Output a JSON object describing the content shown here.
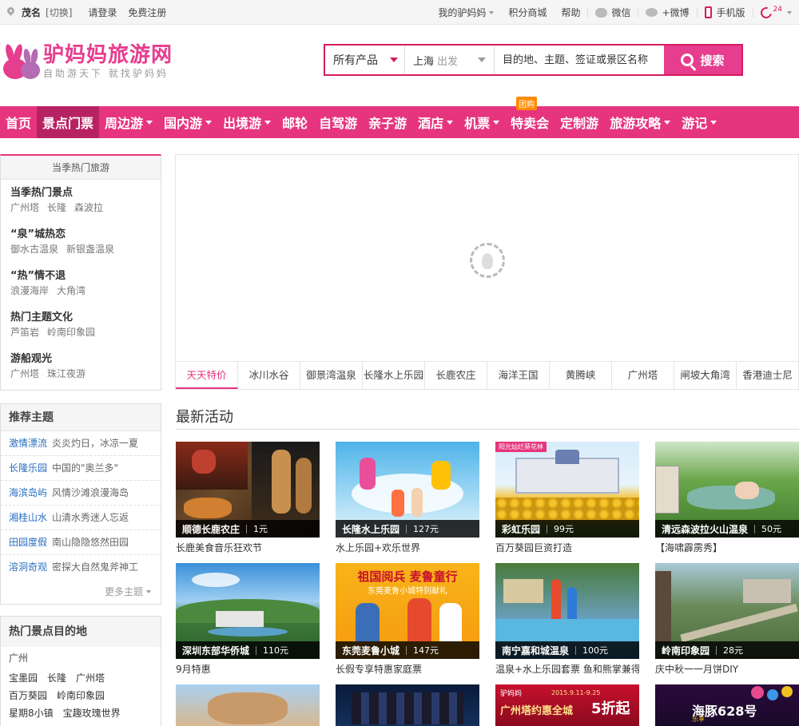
{
  "topbar": {
    "city": "茂名",
    "switch": "[切换]",
    "login": "请登录",
    "register": "免费注册",
    "my": "我的驴妈妈",
    "points": "积分商城",
    "help": "帮助",
    "wechat": "微信",
    "weibo": "+微博",
    "mobile": "手机版",
    "tel_badge": "24"
  },
  "header": {
    "logo_name": "驴妈妈旅游网",
    "slogan": "自助游天下 就找驴妈妈",
    "search": {
      "product": "所有产品",
      "city": "上海",
      "depart": "出发",
      "placeholder": "目的地、主题、签证或景区名称",
      "button": "搜索"
    }
  },
  "nav": {
    "items": [
      {
        "label": "首页"
      },
      {
        "label": "景点门票"
      },
      {
        "label": "周边游"
      },
      {
        "label": "国内游"
      },
      {
        "label": "出境游"
      },
      {
        "label": "邮轮"
      },
      {
        "label": "自驾游"
      },
      {
        "label": "亲子游"
      },
      {
        "label": "酒店"
      },
      {
        "label": "机票"
      },
      {
        "label": "特卖会",
        "badge": "团购"
      },
      {
        "label": "定制游"
      },
      {
        "label": "旅游攻略"
      },
      {
        "label": "游记"
      }
    ]
  },
  "hot": {
    "title": "当季热门旅游",
    "groups": [
      {
        "title": "当季热门景点",
        "links": [
          "广州塔",
          "长隆",
          "森波拉"
        ]
      },
      {
        "title": "“泉”城热恋",
        "links": [
          "御水古温泉",
          "新银盏温泉"
        ]
      },
      {
        "title": "“热”情不退",
        "links": [
          "浪漫海岸",
          "大角湾"
        ]
      },
      {
        "title": "热门主题文化",
        "links": [
          "芦笛岩",
          "岭南印象园"
        ]
      },
      {
        "title": "游船观光",
        "links": [
          "广州塔",
          "珠江夜游"
        ]
      }
    ]
  },
  "tabs": [
    "天天特价",
    "冰川水谷",
    "御景湾温泉",
    "长隆水上乐园",
    "长鹿农庄",
    "海洋王国",
    "黄腾峡",
    "广州塔",
    "闸坡大角湾",
    "香港迪士尼"
  ],
  "topics": {
    "title": "推荐主题",
    "rows": [
      {
        "k": "激情漂流",
        "v": "炎炎灼日，冰凉一夏"
      },
      {
        "k": "长隆乐园",
        "v": "中国的\"奥兰多\""
      },
      {
        "k": "海滨岛屿",
        "v": "风情沙滩浪漫海岛"
      },
      {
        "k": "湘桂山水",
        "v": "山清水秀迷人忘返"
      },
      {
        "k": "田园度假",
        "v": "南山隐隐悠然田园"
      },
      {
        "k": "溶洞奇观",
        "v": "密探大自然鬼斧神工"
      }
    ],
    "more": "更多主题"
  },
  "dest": {
    "title": "热门景点目的地",
    "sub": "广州",
    "rows": [
      [
        "宝墨园",
        "长隆",
        "广州塔"
      ],
      [
        "百万葵园",
        "岭南印象园"
      ],
      [
        "星期8小镇",
        "宝趣玫瑰世界"
      ]
    ]
  },
  "activities": {
    "title": "最新活动",
    "cards": [
      {
        "name": "顺德长鹿农庄",
        "price": "1元",
        "desc": "长鹿美食音乐狂欢节"
      },
      {
        "name": "长隆水上乐园",
        "price": "127元",
        "desc": "水上乐园+欢乐世界"
      },
      {
        "name": "彩虹乐园",
        "price": "99元",
        "desc": "百万葵园巨资打造",
        "tag": "阳光灿烂葵花林"
      },
      {
        "name": "清远森波拉火山温泉",
        "price": "50元",
        "desc": "【海啸霹雳秀】"
      },
      {
        "name": "深圳东部华侨城",
        "price": "110元",
        "desc": "9月特惠"
      },
      {
        "name": "东莞麦鲁小城",
        "price": "147元",
        "desc": "长假专享特惠家庭票",
        "banner1": "祖国阅兵 麦鲁童行",
        "banner2": "东莞麦鲁小城特别献礼"
      },
      {
        "name": "南宁嘉和城温泉",
        "price": "100元",
        "desc": "温泉+水上乐园套票 鱼和熊掌兼得"
      },
      {
        "name": "岭南印象园",
        "price": "28元",
        "desc": "庆中秋一一月饼DIY"
      }
    ],
    "bottom": [
      {
        "text": ""
      },
      {
        "text": ""
      },
      {
        "text": "广州塔约惠全城",
        "sub": "驴妈妈",
        "big": "5折起",
        "date": "2015.9.11-9.25"
      },
      {
        "text": "海豚628号",
        "sub": "乐享"
      }
    ]
  },
  "colors": {
    "brand": "#e6357e",
    "nav_active": "#b72263"
  }
}
